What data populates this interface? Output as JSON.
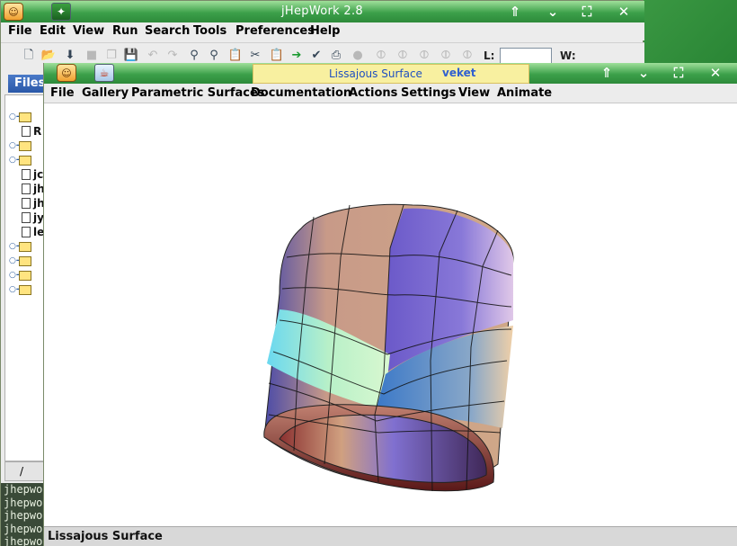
{
  "back_window": {
    "title": "jHepWork 2.8",
    "menu": [
      "File",
      "Edit",
      "View",
      "Run",
      "Search",
      "Tools",
      "Preferences",
      "Help"
    ],
    "toolbar": {
      "l_label": "L:",
      "w_label": "W:",
      "l_value": ""
    },
    "files_tab": "Files",
    "tree_items": [
      {
        "kind": "folder",
        "label": ""
      },
      {
        "kind": "doc",
        "label": "R"
      },
      {
        "kind": "folder",
        "label": ""
      },
      {
        "kind": "folder",
        "label": ""
      },
      {
        "kind": "doc",
        "label": "jc"
      },
      {
        "kind": "doc",
        "label": "jh"
      },
      {
        "kind": "doc",
        "label": "jh"
      },
      {
        "kind": "doc",
        "label": "jy"
      },
      {
        "kind": "doc",
        "label": "le"
      },
      {
        "kind": "folder",
        "label": ""
      },
      {
        "kind": "folder",
        "label": ""
      },
      {
        "kind": "folder",
        "label": ""
      },
      {
        "kind": "folder",
        "label": ""
      }
    ],
    "bottom_tab": "/",
    "console_lines": [
      "jhepwo",
      "jhepwo",
      "jhepwo",
      "jhepwo",
      "jhepwo"
    ]
  },
  "front_window": {
    "title": "Lissajous Surface",
    "title_extra": "veket",
    "menu": [
      "File",
      "Gallery",
      "Parametric Surfaces",
      "Documentation",
      "Actions",
      "Settings",
      "View",
      "Animate"
    ],
    "status": "Lissajous Surface"
  },
  "colors": {
    "titlebar": "#3ca04a",
    "title_highlight": "#f8f0a0",
    "accent": "#2a58a8"
  },
  "icons": [
    "app-icon",
    "java-icon",
    "shade-icon",
    "minimize-icon",
    "maximize-icon",
    "close-icon"
  ]
}
